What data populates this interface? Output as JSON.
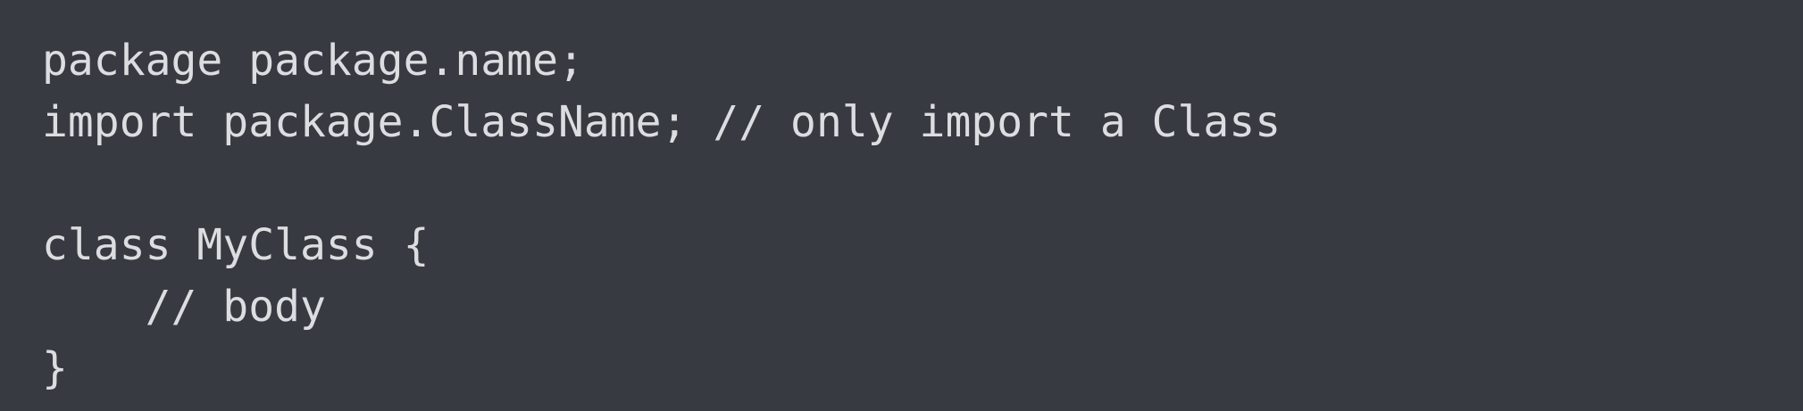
{
  "code_block": {
    "language": "java",
    "background_color": "#373a41",
    "text_color": "#dcdde0",
    "lines": [
      "package package.name;",
      "import package.ClassName; // only import a Class",
      "",
      "class MyClass {",
      "    // body",
      "}"
    ]
  }
}
